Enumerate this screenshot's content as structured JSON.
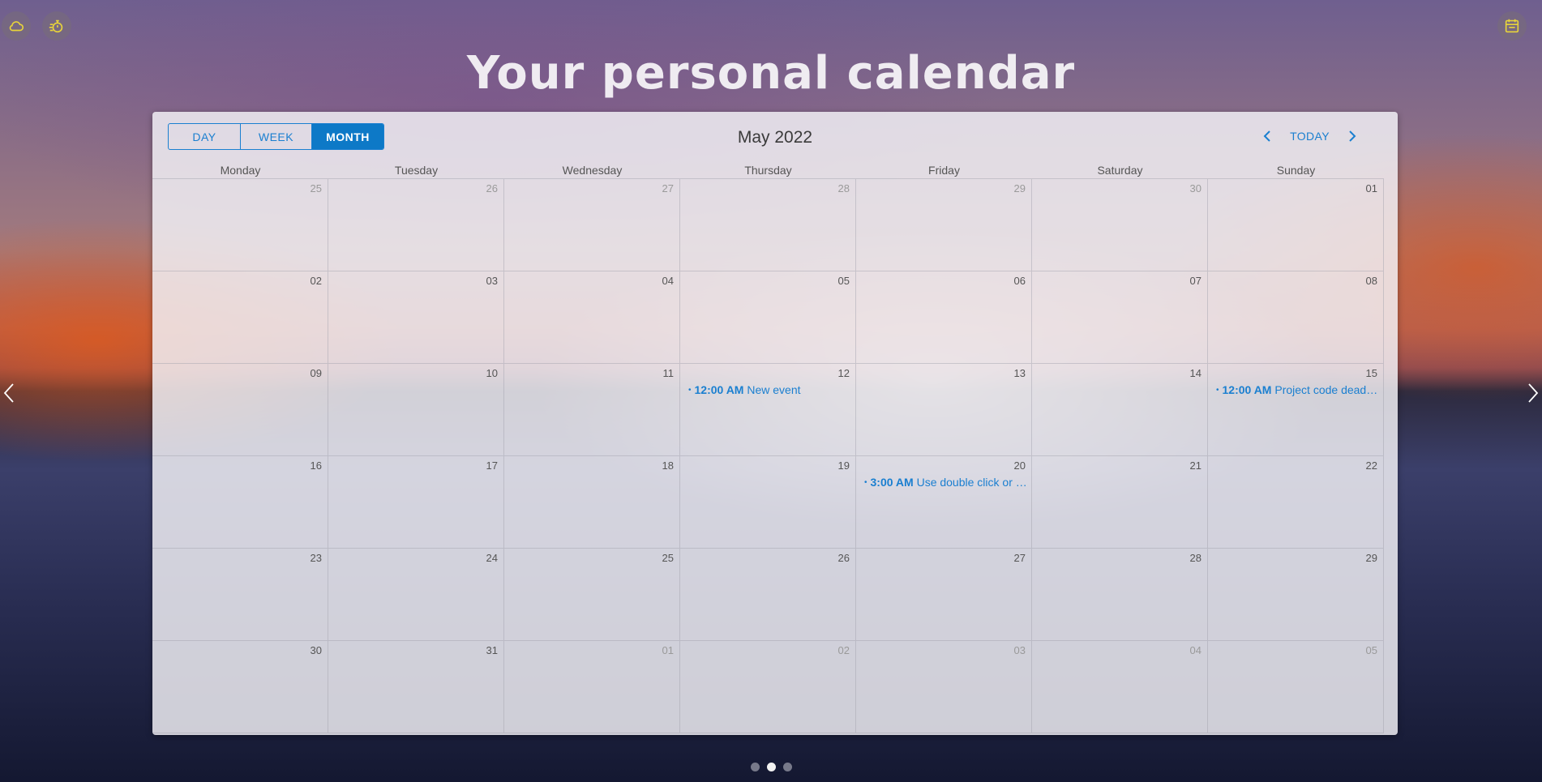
{
  "title": "Your personal calendar",
  "toolbar": {
    "views": [
      {
        "label": "DAY",
        "active": false
      },
      {
        "label": "WEEK",
        "active": false
      },
      {
        "label": "MONTH",
        "active": true
      }
    ],
    "month_label": "May 2022",
    "today_label": "TODAY"
  },
  "weekdays": [
    "Monday",
    "Tuesday",
    "Wednesday",
    "Thursday",
    "Friday",
    "Saturday",
    "Sunday"
  ],
  "weeks": [
    [
      {
        "day": "25",
        "other": true
      },
      {
        "day": "26",
        "other": true
      },
      {
        "day": "27",
        "other": true
      },
      {
        "day": "28",
        "other": true
      },
      {
        "day": "29",
        "other": true
      },
      {
        "day": "30",
        "other": true
      },
      {
        "day": "01",
        "other": false
      }
    ],
    [
      {
        "day": "02",
        "other": false
      },
      {
        "day": "03",
        "other": false
      },
      {
        "day": "04",
        "other": false
      },
      {
        "day": "05",
        "other": false
      },
      {
        "day": "06",
        "other": false
      },
      {
        "day": "07",
        "other": false
      },
      {
        "day": "08",
        "other": false
      }
    ],
    [
      {
        "day": "09",
        "other": false
      },
      {
        "day": "10",
        "other": false
      },
      {
        "day": "11",
        "other": false
      },
      {
        "day": "12",
        "other": false,
        "event": {
          "time": "12:00 AM",
          "title": "New event"
        }
      },
      {
        "day": "13",
        "other": false
      },
      {
        "day": "14",
        "other": false
      },
      {
        "day": "15",
        "other": false,
        "event": {
          "time": "12:00 AM",
          "title": "Project code deadline"
        }
      }
    ],
    [
      {
        "day": "16",
        "other": false
      },
      {
        "day": "17",
        "other": false
      },
      {
        "day": "18",
        "other": false
      },
      {
        "day": "19",
        "other": false
      },
      {
        "day": "20",
        "other": false,
        "event": {
          "time": "3:00 AM",
          "title": "Use double click or long press to create an event"
        }
      },
      {
        "day": "21",
        "other": false
      },
      {
        "day": "22",
        "other": false
      }
    ],
    [
      {
        "day": "23",
        "other": false
      },
      {
        "day": "24",
        "other": false
      },
      {
        "day": "25",
        "other": false
      },
      {
        "day": "26",
        "other": false
      },
      {
        "day": "27",
        "other": false
      },
      {
        "day": "28",
        "other": false
      },
      {
        "day": "29",
        "other": false
      }
    ],
    [
      {
        "day": "30",
        "other": false
      },
      {
        "day": "31",
        "other": false
      },
      {
        "day": "01",
        "other": true
      },
      {
        "day": "02",
        "other": true
      },
      {
        "day": "03",
        "other": true
      },
      {
        "day": "04",
        "other": true
      },
      {
        "day": "05",
        "other": true
      }
    ]
  ],
  "pagination": {
    "count": 3,
    "active": 1
  },
  "icons": {
    "weather": "cloud-icon",
    "timer": "stopwatch-icon",
    "calendar": "calendar-icon",
    "prev_slide": "chevron-left-icon",
    "next_slide": "chevron-right-icon"
  },
  "colors": {
    "accent": "#1a7fd0",
    "icon_yellow": "#e8d43a"
  }
}
